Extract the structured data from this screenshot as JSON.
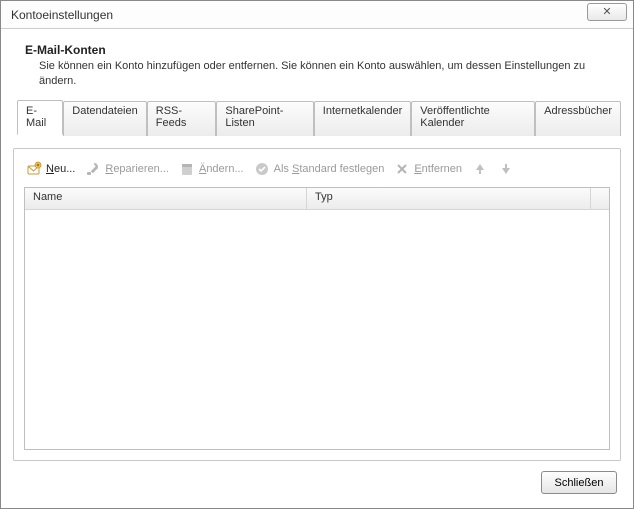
{
  "window": {
    "title": "Kontoeinstellungen",
    "close_glyph": "✕"
  },
  "header": {
    "title": "E-Mail-Konten",
    "description": "Sie können ein Konto hinzufügen oder entfernen. Sie können ein Konto auswählen, um dessen Einstellungen zu ändern."
  },
  "tabs": {
    "email": "E-Mail",
    "datafiles": "Datendateien",
    "rss": "RSS-Feeds",
    "sharepoint": "SharePoint-Listen",
    "internetcal": "Internetkalender",
    "publishedcal": "Veröffentlichte Kalender",
    "addressbooks": "Adressbücher",
    "active": "email"
  },
  "toolbar": {
    "new": "Neu...",
    "repair": "Reparieren...",
    "change": "Ändern...",
    "setdefault": "Als Standard festlegen",
    "remove": "Entfernen"
  },
  "list": {
    "columns": {
      "name": "Name",
      "type": "Typ"
    },
    "rows": []
  },
  "footer": {
    "close": "Schließen"
  }
}
